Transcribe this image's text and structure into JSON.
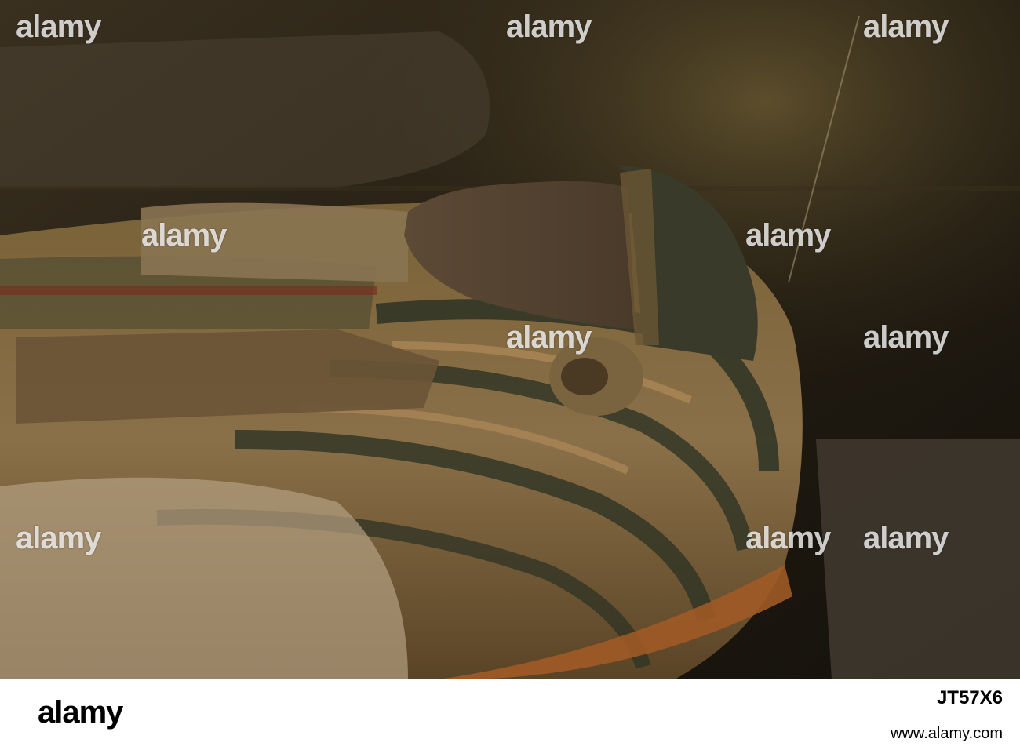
{
  "photo": {
    "subject": "sarcophagus",
    "colors": {
      "background": "#2a2214",
      "wood": "#6b5532",
      "stripe_dark": "#2d3324",
      "highlight": "#b8905c"
    }
  },
  "watermark": {
    "text": "alamy"
  },
  "footer": {
    "brand": "alamy",
    "image_id": "JT57X6",
    "url": "www.alamy.com"
  }
}
